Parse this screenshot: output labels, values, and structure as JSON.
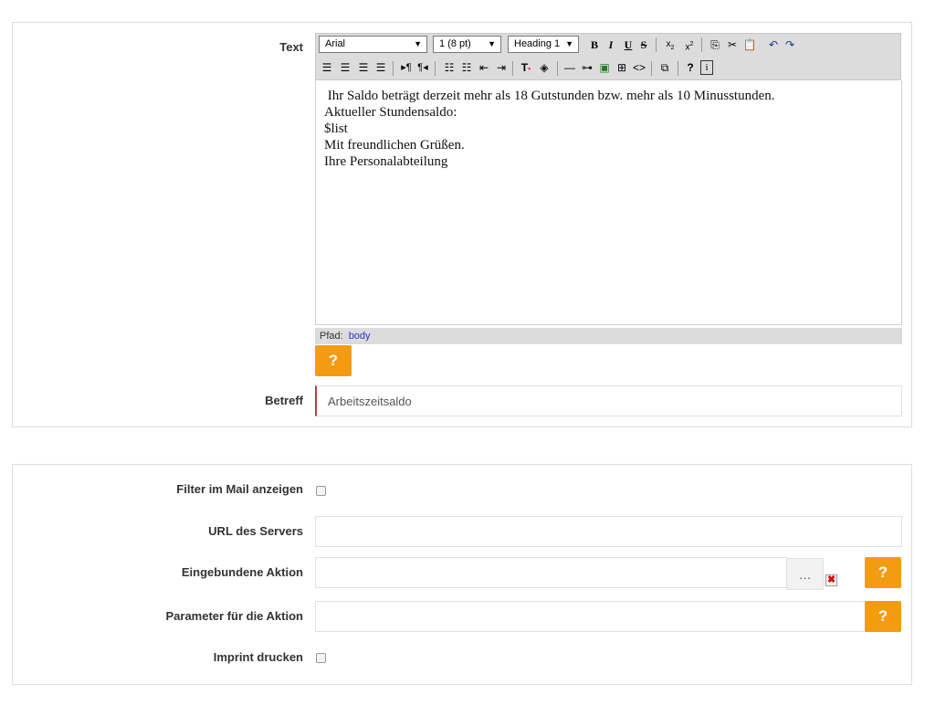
{
  "mail_panel": {
    "text_label": "Text",
    "toolbar": {
      "font_family": "Arial",
      "font_size": "1 (8 pt)",
      "format_block": "Heading 1",
      "bold": "B",
      "italic": "I",
      "underline": "U",
      "strike": "S",
      "help": "?"
    },
    "editor_lines": [
      " Ihr Saldo beträgt derzeit mehr als 18 Gutstunden bzw. mehr als 10 Minusstunden.",
      "",
      "Aktueller Stundensaldo:",
      "$list",
      "",
      "Mit freundlichen Grüßen.",
      "Ihre Personalabteilung"
    ],
    "path_label": "Pfad:",
    "path_value": "body",
    "help_button": "?",
    "subject_label": "Betreff",
    "subject_value": "Arbeitszeitsaldo"
  },
  "options_panel": {
    "show_filter_label": "Filter im Mail anzeigen",
    "server_url_label": "URL des Servers",
    "server_url_value": "",
    "action_label": "Eingebundene Aktion",
    "action_value": "",
    "action_browse": "…",
    "action_clear": "✖",
    "action_params_label": "Parameter für die Aktion",
    "action_params_value": "",
    "help_button": "?",
    "imprint_label": "Imprint drucken"
  },
  "colors": {
    "accent": "#f39c12",
    "toolbar_bg": "#dcdcdc",
    "required_marker": "#a94442"
  }
}
